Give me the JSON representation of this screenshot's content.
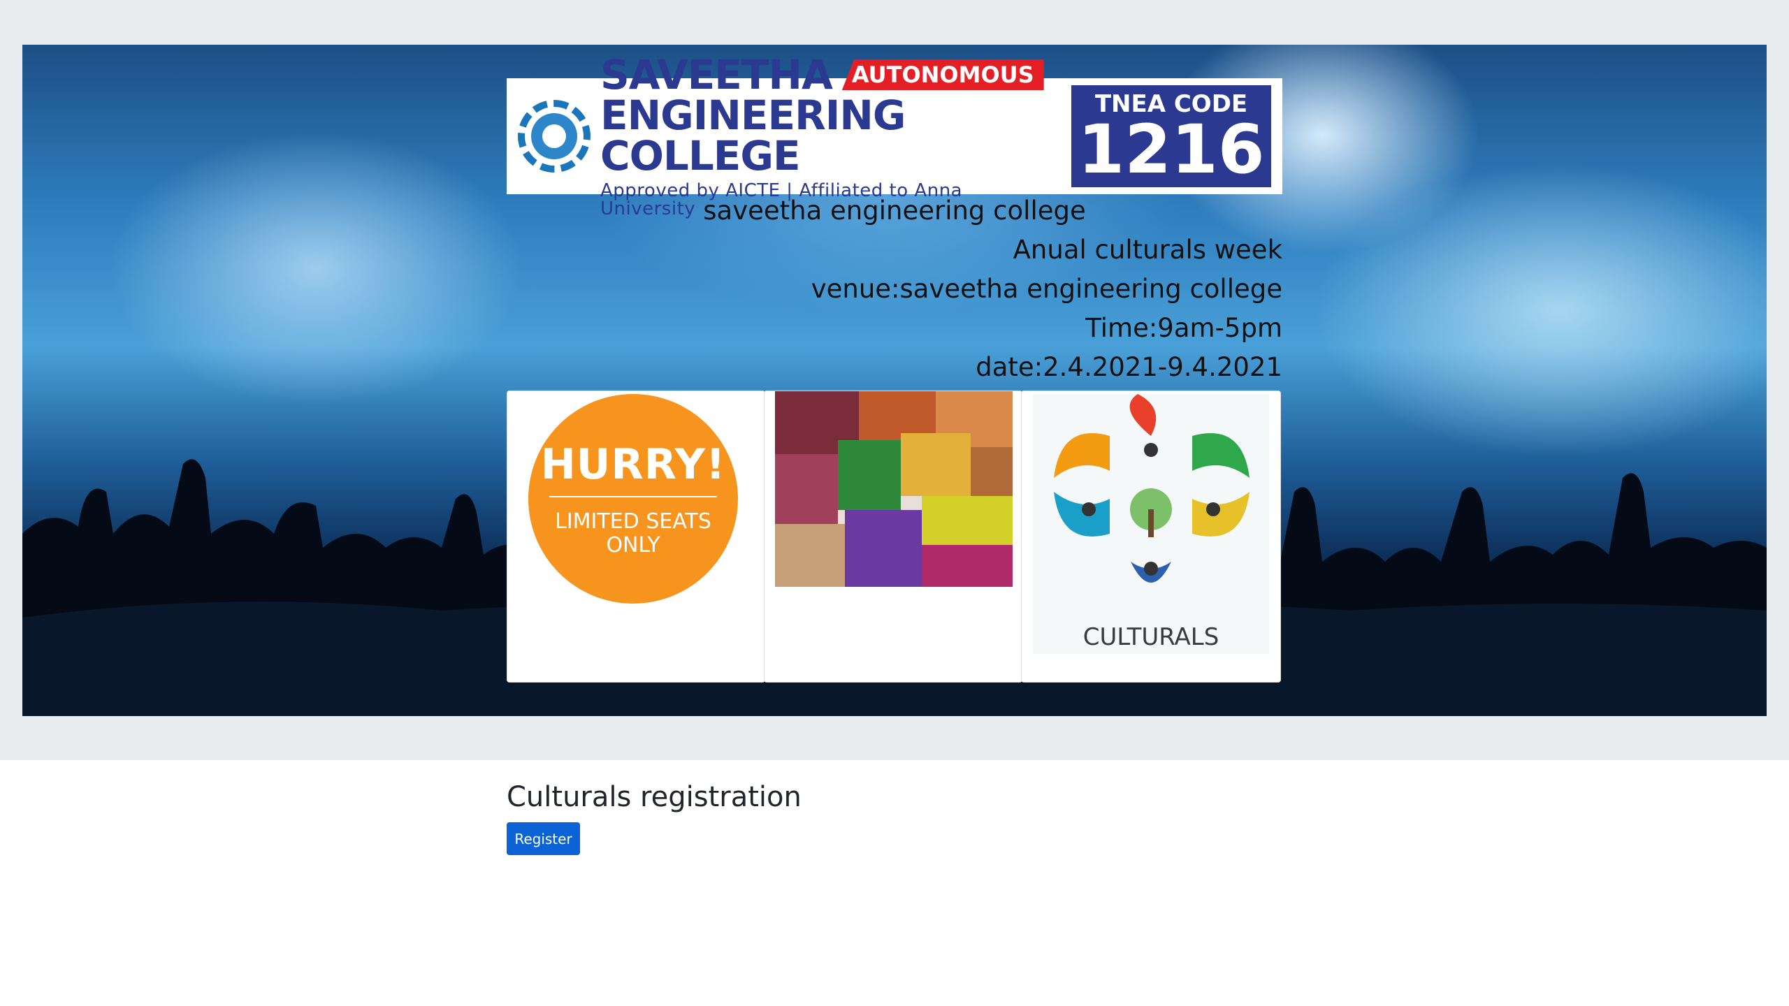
{
  "logo": {
    "college_line1": "SAVEETHA",
    "autonomous_badge": "AUTONOMOUS",
    "college_line2": "ENGINEERING COLLEGE",
    "approval_line": "Approved by AICTE | Affiliated to Anna University",
    "tnea_label": "TNEA CODE",
    "tnea_code": "1216"
  },
  "event": {
    "college": "saveetha engineering college",
    "title": "Anual culturals week",
    "venue": "venue:saveetha engineering college",
    "time": "Time:9am-5pm",
    "date": "date:2.4.2021-9.4.2021"
  },
  "cards": {
    "hurry_title": "HURRY!",
    "hurry_sub": "LIMITED SEATS ONLY",
    "culturals_label": "CULTURALS"
  },
  "registration": {
    "heading": "Culturals registration",
    "button_label": "Register"
  },
  "colors": {
    "jumbotron_bg": "#e9ecef",
    "button_bg": "#0b63d6",
    "brand_blue": "#2b3990",
    "badge_red": "#e31e24",
    "hurry_orange": "#f7941d"
  }
}
